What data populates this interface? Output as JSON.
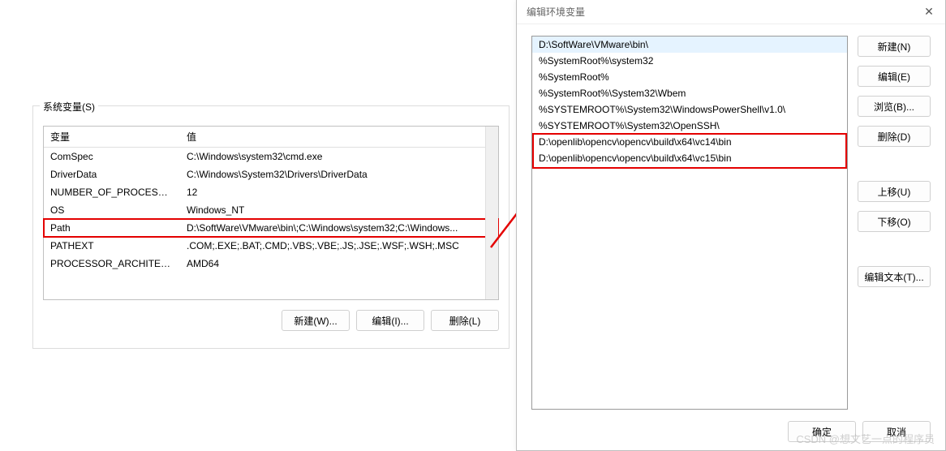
{
  "left": {
    "group_title": "系统变量(S)",
    "columns": {
      "var": "变量",
      "val": "值"
    },
    "rows": [
      {
        "var": "ComSpec",
        "val": "C:\\Windows\\system32\\cmd.exe",
        "hl": false
      },
      {
        "var": "DriverData",
        "val": "C:\\Windows\\System32\\Drivers\\DriverData",
        "hl": false
      },
      {
        "var": "NUMBER_OF_PROCESSORS",
        "val": "12",
        "hl": false
      },
      {
        "var": "OS",
        "val": "Windows_NT",
        "hl": false
      },
      {
        "var": "Path",
        "val": "D:\\SoftWare\\VMware\\bin\\;C:\\Windows\\system32;C:\\Windows...",
        "hl": true
      },
      {
        "var": "PATHEXT",
        "val": ".COM;.EXE;.BAT;.CMD;.VBS;.VBE;.JS;.JSE;.WSF;.WSH;.MSC",
        "hl": false
      },
      {
        "var": "PROCESSOR_ARCHITECT...",
        "val": "AMD64",
        "hl": false
      }
    ],
    "buttons": {
      "new": "新建(W)...",
      "edit": "编辑(I)...",
      "delete": "删除(L)"
    }
  },
  "right": {
    "title": "编辑环境变量",
    "items": [
      {
        "text": "D:\\SoftWare\\VMware\\bin\\",
        "selected": true
      },
      {
        "text": "%SystemRoot%\\system32",
        "selected": false
      },
      {
        "text": "%SystemRoot%",
        "selected": false
      },
      {
        "text": "%SystemRoot%\\System32\\Wbem",
        "selected": false
      },
      {
        "text": "%SYSTEMROOT%\\System32\\WindowsPowerShell\\v1.0\\",
        "selected": false
      },
      {
        "text": "%SYSTEMROOT%\\System32\\OpenSSH\\",
        "selected": false
      },
      {
        "text": "D:\\openlib\\opencv\\opencv\\build\\x64\\vc14\\bin",
        "selected": false
      },
      {
        "text": "D:\\openlib\\opencv\\opencv\\build\\x64\\vc15\\bin",
        "selected": false
      }
    ],
    "buttons": {
      "new": "新建(N)",
      "edit": "编辑(E)",
      "browse": "浏览(B)...",
      "delete": "删除(D)",
      "up": "上移(U)",
      "down": "下移(O)",
      "edit_text": "编辑文本(T)..."
    },
    "footer": {
      "ok": "确定",
      "cancel": "取消"
    }
  },
  "watermark": "CSDN @想文艺一点的程序员"
}
